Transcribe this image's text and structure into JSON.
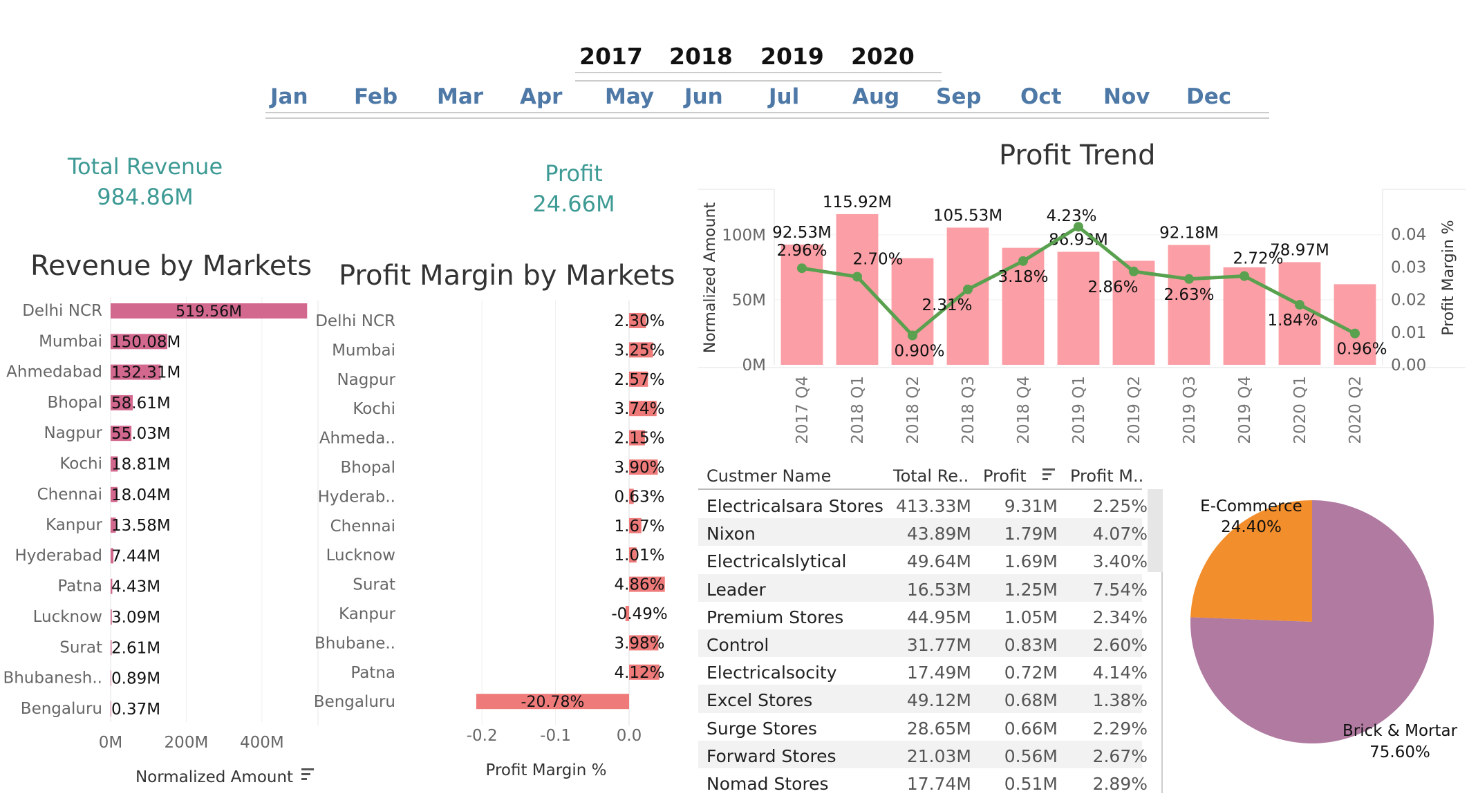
{
  "filters": {
    "years": [
      "2017",
      "2018",
      "2019",
      "2020"
    ],
    "months": [
      "Jan",
      "Feb",
      "Mar",
      "Apr",
      "May",
      "Jun",
      "Jul",
      "Aug",
      "Sep",
      "Oct",
      "Nov",
      "Dec"
    ]
  },
  "kpis": {
    "revenue_label": "Total Revenue",
    "revenue_value": "984.86M",
    "profit_label": "Profit",
    "profit_value": "24.66M"
  },
  "colors": {
    "revenue_bar": "#d3688e",
    "margin_bar": "#ef7a7a",
    "trend_bar": "#fb9ea5",
    "trend_line": "#59a14f",
    "ecommerce": "#f28e2b",
    "brick": "#b07aa1",
    "kpi": "#3d9a94",
    "filter": "#4e79a7"
  },
  "chart_data": [
    {
      "type": "bar",
      "orientation": "horizontal",
      "title": "Revenue by Markets",
      "xlabel": "Normalized Amount",
      "xlim": [
        0,
        530
      ],
      "xticks": [
        "0M",
        "200M",
        "400M"
      ],
      "categories": [
        "Delhi NCR",
        "Mumbai",
        "Ahmedabad",
        "Bhopal",
        "Nagpur",
        "Kochi",
        "Chennai",
        "Kanpur",
        "Hyderabad",
        "Patna",
        "Lucknow",
        "Surat",
        "Bhubanesh..",
        "Bengaluru"
      ],
      "values": [
        519.56,
        150.08,
        132.31,
        58.61,
        55.03,
        18.81,
        18.04,
        13.58,
        7.44,
        4.43,
        3.09,
        2.61,
        0.89,
        0.37
      ],
      "labels": [
        "519.56M",
        "150.08M",
        "132.31M",
        "58.61M",
        "55.03M",
        "18.81M",
        "18.04M",
        "13.58M",
        "7.44M",
        "4.43M",
        "3.09M",
        "2.61M",
        "0.89M",
        "0.37M"
      ]
    },
    {
      "type": "bar",
      "orientation": "horizontal",
      "title": "Profit Margin by Markets",
      "xlabel": "Profit Margin %",
      "xlim": [
        -0.21,
        0.06
      ],
      "xticks": [
        "-0.2",
        "-0.1",
        "0.0"
      ],
      "categories": [
        "Delhi NCR",
        "Mumbai",
        "Nagpur",
        "Kochi",
        "Ahmeda..",
        "Bhopal",
        "Hyderab..",
        "Chennai",
        "Lucknow",
        "Surat",
        "Kanpur",
        "Bhubane..",
        "Patna",
        "Bengaluru"
      ],
      "values": [
        0.023,
        0.0325,
        0.0257,
        0.0374,
        0.0215,
        0.039,
        0.0063,
        0.0167,
        0.0101,
        0.0486,
        -0.0049,
        0.0398,
        0.0412,
        -0.2078
      ],
      "labels": [
        "2.30%",
        "3.25%",
        "2.57%",
        "3.74%",
        "2.15%",
        "3.90%",
        "0.63%",
        "1.67%",
        "1.01%",
        "4.86%",
        "-0.49%",
        "3.98%",
        "4.12%",
        "-20.78%"
      ]
    },
    {
      "type": "bar+line",
      "title": "Profit Trend",
      "ylabel": "Normalized Amount",
      "y2label": "Profit Margin %",
      "ylim": [
        0,
        135
      ],
      "y2lim": [
        0,
        0.045
      ],
      "yticks": [
        "0M",
        "50M",
        "100M"
      ],
      "y2ticks": [
        "0.00",
        "0.01",
        "0.02",
        "0.03",
        "0.04"
      ],
      "categories": [
        "2017 Q4",
        "2018 Q1",
        "2018 Q2",
        "2018 Q3",
        "2018 Q4",
        "2019 Q1",
        "2019 Q2",
        "2019 Q3",
        "2019 Q4",
        "2020 Q1",
        "2020 Q2"
      ],
      "bar_values": [
        92.53,
        115.92,
        82.0,
        105.53,
        90.0,
        86.93,
        80.0,
        92.18,
        75.0,
        78.97,
        62.0
      ],
      "bar_labels": [
        "92.53M",
        "115.92M",
        "",
        "105.53M",
        "",
        "86.93M",
        "",
        "92.18M",
        "",
        "78.97M",
        ""
      ],
      "line_values": [
        0.0296,
        0.027,
        0.009,
        0.0231,
        0.0318,
        0.0423,
        0.0286,
        0.0263,
        0.0272,
        0.0184,
        0.0096
      ],
      "line_labels": [
        "2.96%",
        "2.70%",
        "0.90%",
        "2.31%",
        "3.18%",
        "4.23%",
        "2.86%",
        "2.63%",
        "2.72%",
        "1.84%",
        "0.96%"
      ]
    },
    {
      "type": "table",
      "columns": [
        "Custmer Name",
        "Total Re..",
        "Profit",
        "Profit M.."
      ],
      "rows": [
        [
          "Electricalsara Stores",
          "413.33M",
          "9.31M",
          "2.25%"
        ],
        [
          "Nixon",
          "43.89M",
          "1.79M",
          "4.07%"
        ],
        [
          "Electricalslytical",
          "49.64M",
          "1.69M",
          "3.40%"
        ],
        [
          "Leader",
          "16.53M",
          "1.25M",
          "7.54%"
        ],
        [
          "Premium Stores",
          "44.95M",
          "1.05M",
          "2.34%"
        ],
        [
          "Control",
          "31.77M",
          "0.83M",
          "2.60%"
        ],
        [
          "Electricalsocity",
          "17.49M",
          "0.72M",
          "4.14%"
        ],
        [
          "Excel Stores",
          "49.12M",
          "0.68M",
          "1.38%"
        ],
        [
          "Surge Stores",
          "28.65M",
          "0.66M",
          "2.29%"
        ],
        [
          "Forward Stores",
          "21.03M",
          "0.56M",
          "2.67%"
        ],
        [
          "Nomad Stores",
          "17.74M",
          "0.51M",
          "2.89%"
        ]
      ]
    },
    {
      "type": "pie",
      "categories": [
        "E-Commerce",
        "Brick & Mortar"
      ],
      "values": [
        24.4,
        75.6
      ],
      "labels": [
        "24.40%",
        "75.60%"
      ]
    }
  ]
}
